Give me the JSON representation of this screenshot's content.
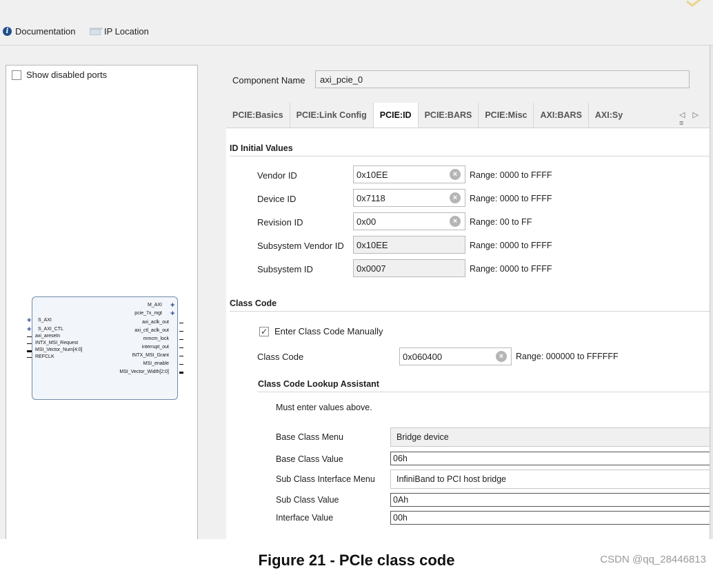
{
  "toolbar": {
    "documentation": "Documentation",
    "ip_location": "IP Location"
  },
  "left_panel": {
    "show_disabled_ports": "Show disabled ports",
    "block": {
      "left_ports": [
        "S_AXI",
        "S_AXI_CTL",
        "axi_aresetn",
        "INTX_MSI_Request",
        "MSI_Vector_Num[4:0]",
        "REFCLK"
      ],
      "right_ports": [
        "M_AXI",
        "pcie_7x_mgt",
        "axi_aclk_out",
        "axi_ctl_aclk_out",
        "mmcm_lock",
        "interrupt_out",
        "INTX_MSI_Grant",
        "MSI_enable",
        "MSI_Vector_Width[2:0]"
      ]
    }
  },
  "component": {
    "label": "Component Name",
    "value": "axi_pcie_0"
  },
  "tabs": [
    {
      "label": "PCIE:Basics"
    },
    {
      "label": "PCIE:Link Config"
    },
    {
      "label": "PCIE:ID"
    },
    {
      "label": "PCIE:BARS"
    },
    {
      "label": "PCIE:Misc"
    },
    {
      "label": "AXI:BARS"
    },
    {
      "label": "AXI:Sy"
    }
  ],
  "tab_nav": "◁ ▷ ≡",
  "id_section": {
    "title": "ID Initial Values",
    "rows": [
      {
        "label": "Vendor ID",
        "value": "0x10EE",
        "range": "Range: 0000 to FFFF"
      },
      {
        "label": "Device ID",
        "value": "0x7118",
        "range": "Range: 0000 to FFFF"
      },
      {
        "label": "Revision ID",
        "value": "0x00",
        "range": "Range: 00 to FF"
      },
      {
        "label": "Subsystem Vendor ID",
        "value": "0x10EE",
        "range": "Range: 0000 to FFFF"
      },
      {
        "label": "Subsystem ID",
        "value": "0x0007",
        "range": "Range: 0000 to FFFF"
      }
    ]
  },
  "class_code": {
    "title": "Class Code",
    "manual_label": "Enter Class Code Manually",
    "manual_checked": true,
    "label": "Class Code",
    "value": "0x060400",
    "range": "Range: 000000 to FFFFFF"
  },
  "lookup": {
    "title": "Class Code Lookup Assistant",
    "note": "Must enter values above.",
    "base_class_menu_label": "Base Class Menu",
    "base_class_menu_value": "Bridge device",
    "base_class_value_label": "Base Class Value",
    "base_class_value": "06h",
    "sub_class_menu_label": "Sub Class Interface Menu",
    "sub_class_menu_value": "InfiniBand to PCI host bridge",
    "sub_class_value_label": "Sub Class Value",
    "sub_class_value": "0Ah",
    "interface_value_label": "Interface Value",
    "interface_value": "00h"
  },
  "caption": "Figure 21 - PCIe class code",
  "watermark": "CSDN @qq_28446813",
  "colors": {
    "accent": "#1f4f8b",
    "panel_bg": "#f0f0f0",
    "block_border": "#6f8aa8"
  }
}
